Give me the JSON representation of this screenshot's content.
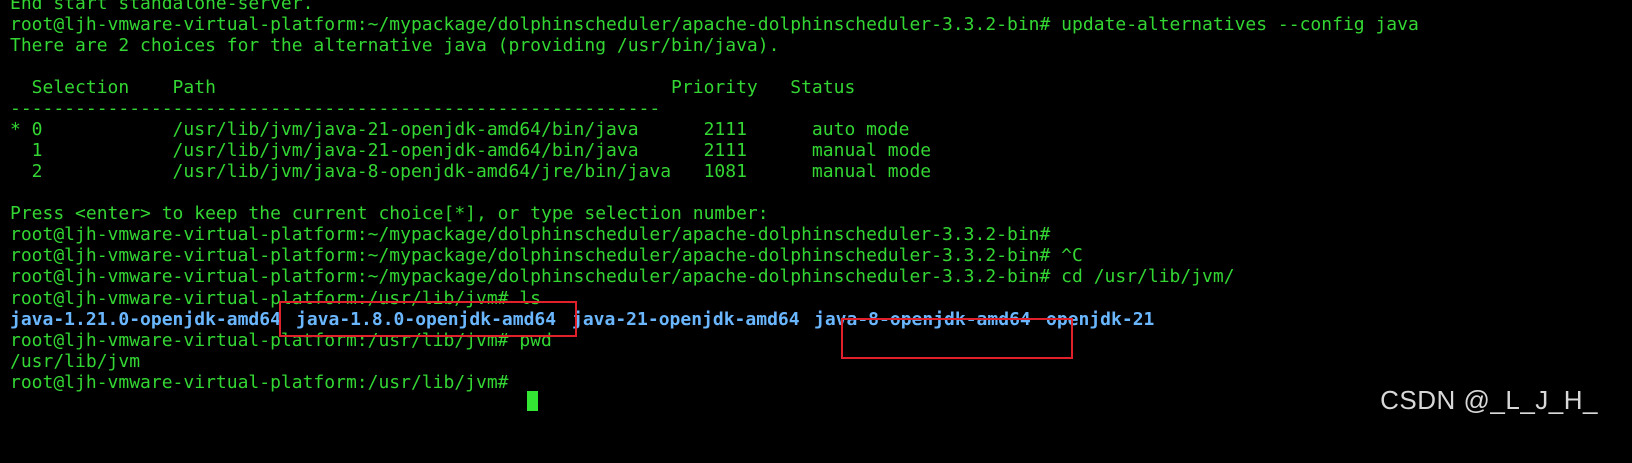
{
  "terminal": {
    "lines": [
      "End start standalone-server.",
      "root@ljh-vmware-virtual-platform:~/mypackage/dolphinscheduler/apache-dolphinscheduler-3.3.2-bin# update-alternatives --config java",
      "There are 2 choices for the alternative java (providing /usr/bin/java).",
      "",
      "  Selection    Path                                          Priority   Status",
      "------------------------------------------------------------",
      "* 0            /usr/lib/jvm/java-21-openjdk-amd64/bin/java      2111      auto mode",
      "  1            /usr/lib/jvm/java-21-openjdk-amd64/bin/java      2111      manual mode",
      "  2            /usr/lib/jvm/java-8-openjdk-amd64/jre/bin/java   1081      manual mode",
      "",
      "Press <enter> to keep the current choice[*], or type selection number:",
      "root@ljh-vmware-virtual-platform:~/mypackage/dolphinscheduler/apache-dolphinscheduler-3.3.2-bin#",
      "root@ljh-vmware-virtual-platform:~/mypackage/dolphinscheduler/apache-dolphinscheduler-3.3.2-bin# ^C",
      "root@ljh-vmware-virtual-platform:~/mypackage/dolphinscheduler/apache-dolphinscheduler-3.3.2-bin# cd /usr/lib/jvm/",
      "root@ljh-vmware-virtual-platform:/usr/lib/jvm# ls"
    ],
    "ls_output": [
      "java-1.21.0-openjdk-amd64",
      "java-1.8.0-openjdk-amd64",
      "java-21-openjdk-amd64",
      "java-8-openjdk-amd64",
      "openjdk-21"
    ],
    "after_lines": [
      "root@ljh-vmware-virtual-platform:/usr/lib/jvm# pwd",
      "/usr/lib/jvm",
      "root@ljh-vmware-virtual-platform:/usr/lib/jvm# "
    ]
  },
  "watermark": "CSDN @_L_J_H_",
  "colors": {
    "background": "#000000",
    "text": "#33d633",
    "directory": "#6ab7ff",
    "highlight_box": "#e0202a",
    "cursor": "#33e633"
  }
}
